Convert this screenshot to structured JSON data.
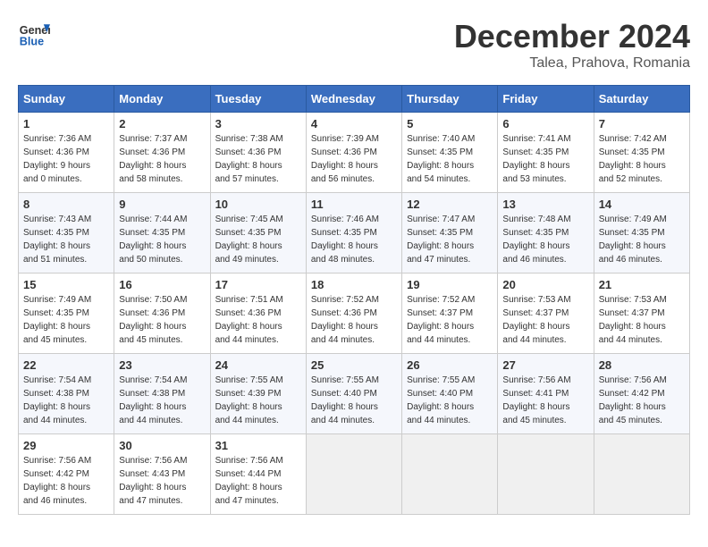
{
  "header": {
    "logo_line1": "General",
    "logo_line2": "Blue",
    "month": "December 2024",
    "location": "Talea, Prahova, Romania"
  },
  "days_of_week": [
    "Sunday",
    "Monday",
    "Tuesday",
    "Wednesday",
    "Thursday",
    "Friday",
    "Saturday"
  ],
  "weeks": [
    [
      {
        "day": 1,
        "info": "Sunrise: 7:36 AM\nSunset: 4:36 PM\nDaylight: 9 hours\nand 0 minutes."
      },
      {
        "day": 2,
        "info": "Sunrise: 7:37 AM\nSunset: 4:36 PM\nDaylight: 8 hours\nand 58 minutes."
      },
      {
        "day": 3,
        "info": "Sunrise: 7:38 AM\nSunset: 4:36 PM\nDaylight: 8 hours\nand 57 minutes."
      },
      {
        "day": 4,
        "info": "Sunrise: 7:39 AM\nSunset: 4:36 PM\nDaylight: 8 hours\nand 56 minutes."
      },
      {
        "day": 5,
        "info": "Sunrise: 7:40 AM\nSunset: 4:35 PM\nDaylight: 8 hours\nand 54 minutes."
      },
      {
        "day": 6,
        "info": "Sunrise: 7:41 AM\nSunset: 4:35 PM\nDaylight: 8 hours\nand 53 minutes."
      },
      {
        "day": 7,
        "info": "Sunrise: 7:42 AM\nSunset: 4:35 PM\nDaylight: 8 hours\nand 52 minutes."
      }
    ],
    [
      {
        "day": 8,
        "info": "Sunrise: 7:43 AM\nSunset: 4:35 PM\nDaylight: 8 hours\nand 51 minutes."
      },
      {
        "day": 9,
        "info": "Sunrise: 7:44 AM\nSunset: 4:35 PM\nDaylight: 8 hours\nand 50 minutes."
      },
      {
        "day": 10,
        "info": "Sunrise: 7:45 AM\nSunset: 4:35 PM\nDaylight: 8 hours\nand 49 minutes."
      },
      {
        "day": 11,
        "info": "Sunrise: 7:46 AM\nSunset: 4:35 PM\nDaylight: 8 hours\nand 48 minutes."
      },
      {
        "day": 12,
        "info": "Sunrise: 7:47 AM\nSunset: 4:35 PM\nDaylight: 8 hours\nand 47 minutes."
      },
      {
        "day": 13,
        "info": "Sunrise: 7:48 AM\nSunset: 4:35 PM\nDaylight: 8 hours\nand 46 minutes."
      },
      {
        "day": 14,
        "info": "Sunrise: 7:49 AM\nSunset: 4:35 PM\nDaylight: 8 hours\nand 46 minutes."
      }
    ],
    [
      {
        "day": 15,
        "info": "Sunrise: 7:49 AM\nSunset: 4:35 PM\nDaylight: 8 hours\nand 45 minutes."
      },
      {
        "day": 16,
        "info": "Sunrise: 7:50 AM\nSunset: 4:36 PM\nDaylight: 8 hours\nand 45 minutes."
      },
      {
        "day": 17,
        "info": "Sunrise: 7:51 AM\nSunset: 4:36 PM\nDaylight: 8 hours\nand 44 minutes."
      },
      {
        "day": 18,
        "info": "Sunrise: 7:52 AM\nSunset: 4:36 PM\nDaylight: 8 hours\nand 44 minutes."
      },
      {
        "day": 19,
        "info": "Sunrise: 7:52 AM\nSunset: 4:37 PM\nDaylight: 8 hours\nand 44 minutes."
      },
      {
        "day": 20,
        "info": "Sunrise: 7:53 AM\nSunset: 4:37 PM\nDaylight: 8 hours\nand 44 minutes."
      },
      {
        "day": 21,
        "info": "Sunrise: 7:53 AM\nSunset: 4:37 PM\nDaylight: 8 hours\nand 44 minutes."
      }
    ],
    [
      {
        "day": 22,
        "info": "Sunrise: 7:54 AM\nSunset: 4:38 PM\nDaylight: 8 hours\nand 44 minutes."
      },
      {
        "day": 23,
        "info": "Sunrise: 7:54 AM\nSunset: 4:38 PM\nDaylight: 8 hours\nand 44 minutes."
      },
      {
        "day": 24,
        "info": "Sunrise: 7:55 AM\nSunset: 4:39 PM\nDaylight: 8 hours\nand 44 minutes."
      },
      {
        "day": 25,
        "info": "Sunrise: 7:55 AM\nSunset: 4:40 PM\nDaylight: 8 hours\nand 44 minutes."
      },
      {
        "day": 26,
        "info": "Sunrise: 7:55 AM\nSunset: 4:40 PM\nDaylight: 8 hours\nand 44 minutes."
      },
      {
        "day": 27,
        "info": "Sunrise: 7:56 AM\nSunset: 4:41 PM\nDaylight: 8 hours\nand 45 minutes."
      },
      {
        "day": 28,
        "info": "Sunrise: 7:56 AM\nSunset: 4:42 PM\nDaylight: 8 hours\nand 45 minutes."
      }
    ],
    [
      {
        "day": 29,
        "info": "Sunrise: 7:56 AM\nSunset: 4:42 PM\nDaylight: 8 hours\nand 46 minutes."
      },
      {
        "day": 30,
        "info": "Sunrise: 7:56 AM\nSunset: 4:43 PM\nDaylight: 8 hours\nand 47 minutes."
      },
      {
        "day": 31,
        "info": "Sunrise: 7:56 AM\nSunset: 4:44 PM\nDaylight: 8 hours\nand 47 minutes."
      },
      null,
      null,
      null,
      null
    ]
  ]
}
